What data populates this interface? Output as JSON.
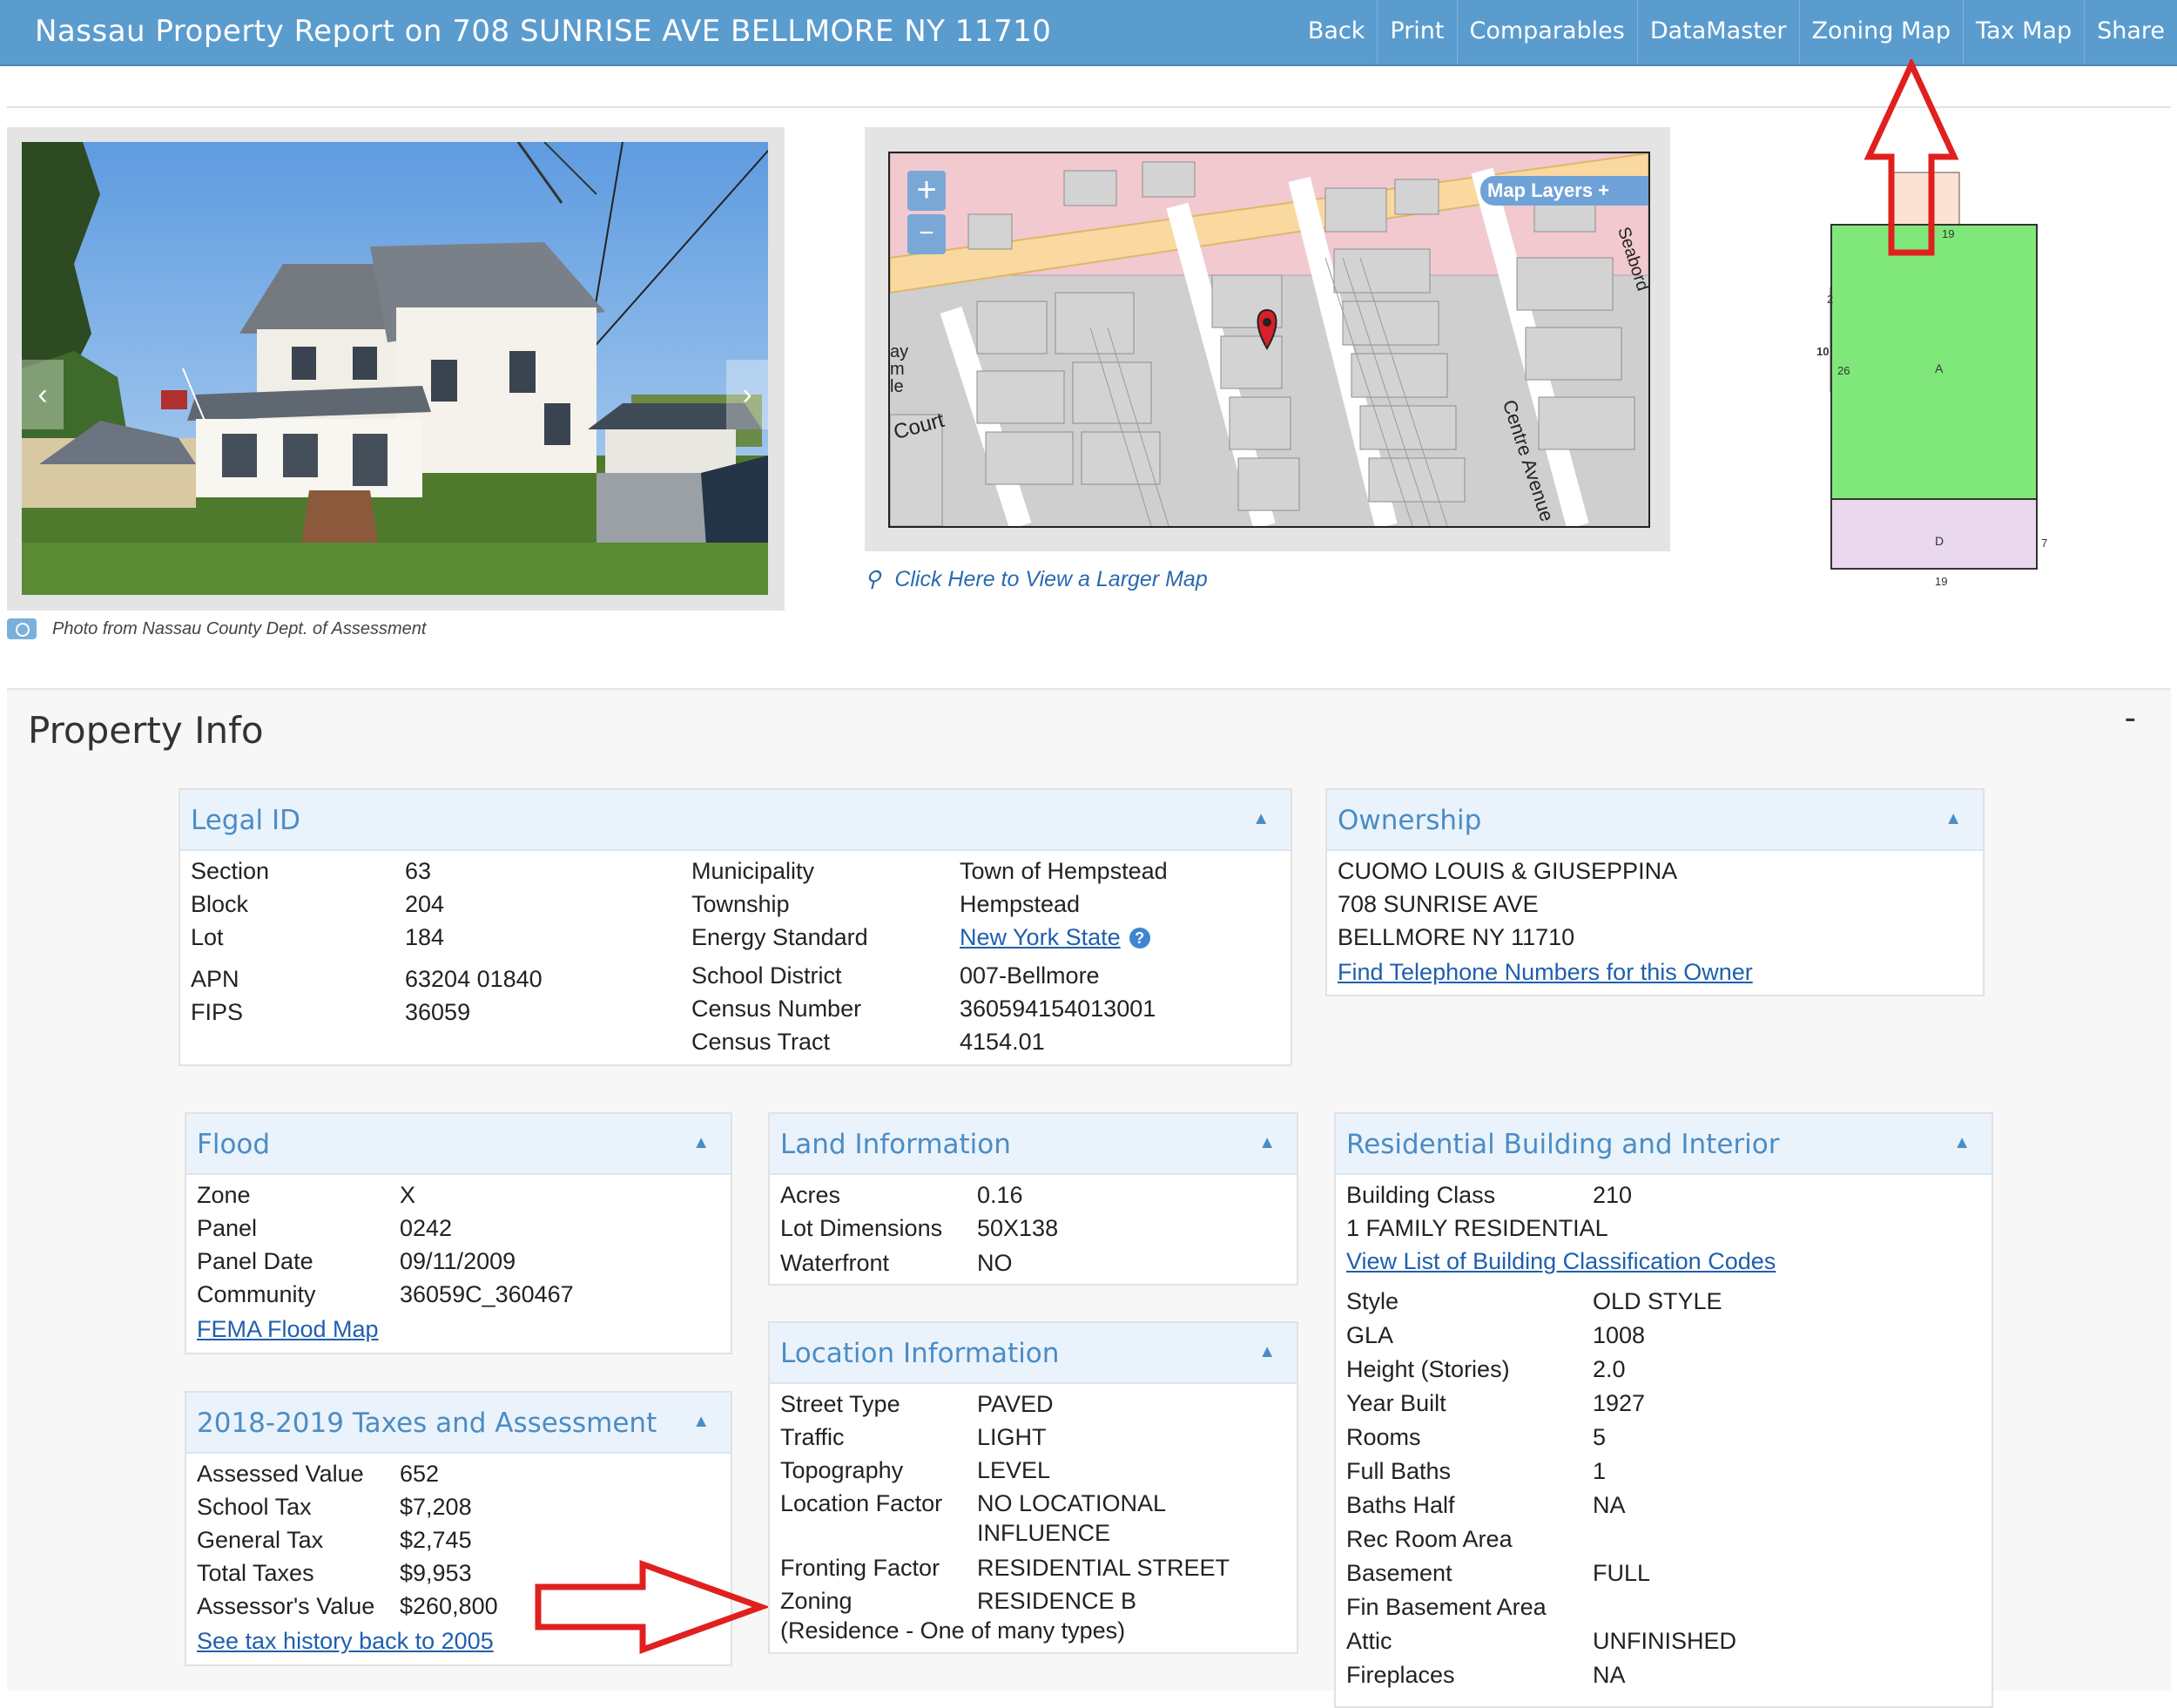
{
  "header": {
    "title": "Nassau Property Report on 708 SUNRISE AVE BELLMORE NY 11710",
    "nav": [
      "Back",
      "Print",
      "Comparables",
      "DataMaster",
      "Zoning Map",
      "Tax Map",
      "Share"
    ]
  },
  "photo": {
    "caption": "Photo from Nassau County Dept. of Assessment"
  },
  "map": {
    "layers_label": "Map Layers",
    "link_text": "Click Here to View a Larger Map",
    "street_labels": [
      "Court",
      "Centre Avenue",
      "Seabord"
    ],
    "partial_labels": [
      "ay",
      "m",
      "le"
    ]
  },
  "sketch": {
    "labels": [
      "A",
      "D",
      "19",
      "26",
      "10",
      "2",
      "7",
      "19"
    ]
  },
  "property_info": {
    "title": "Property Info",
    "collapse": "-"
  },
  "legal_id": {
    "title": "Legal ID",
    "left": [
      {
        "label": "Section",
        "value": "63"
      },
      {
        "label": "Block",
        "value": "204"
      },
      {
        "label": "Lot",
        "value": "184"
      },
      {
        "label": "APN",
        "value": "63204 01840"
      },
      {
        "label": "FIPS",
        "value": "36059"
      }
    ],
    "right": [
      {
        "label": "Municipality",
        "value": "Town of Hempstead"
      },
      {
        "label": "Township",
        "value": "Hempstead"
      },
      {
        "label": "Energy Standard",
        "value": "New York State"
      },
      {
        "label": "School District",
        "value": "007-Bellmore"
      },
      {
        "label": "Census Number",
        "value": "360594154013001"
      },
      {
        "label": "Census Tract",
        "value": "4154.01"
      }
    ]
  },
  "ownership": {
    "title": "Ownership",
    "name": "CUOMO LOUIS & GIUSEPPINA",
    "address1": "708 SUNRISE AVE",
    "address2": "BELLMORE NY 11710",
    "link": "Find Telephone Numbers for this Owner"
  },
  "flood": {
    "title": "Flood",
    "rows": [
      {
        "label": "Zone",
        "value": "X"
      },
      {
        "label": "Panel",
        "value": "0242"
      },
      {
        "label": "Panel Date",
        "value": "09/11/2009"
      },
      {
        "label": "Community",
        "value": "36059C_360467"
      }
    ],
    "link": "FEMA Flood Map"
  },
  "taxes": {
    "title": "2018-2019 Taxes and Assessment",
    "rows": [
      {
        "label": "Assessed Value",
        "value": "652"
      },
      {
        "label": "School Tax",
        "value": "$7,208"
      },
      {
        "label": "General Tax",
        "value": "$2,745"
      },
      {
        "label": "Total Taxes",
        "value": "$9,953"
      },
      {
        "label": "Assessor's Value",
        "value": "$260,800"
      }
    ],
    "link": "See tax history back to 2005"
  },
  "land": {
    "title": "Land Information",
    "rows": [
      {
        "label": "Acres",
        "value": "0.16"
      },
      {
        "label": "Lot Dimensions",
        "value": "50X138"
      },
      {
        "label": "Waterfront",
        "value": "NO"
      }
    ]
  },
  "location": {
    "title": "Location Information",
    "rows": [
      {
        "label": "Street Type",
        "value": "PAVED"
      },
      {
        "label": "Traffic",
        "value": "LIGHT"
      },
      {
        "label": "Topography",
        "value": "LEVEL"
      },
      {
        "label": "Location Factor",
        "value": "NO LOCATIONAL",
        "value2": "INFLUENCE"
      },
      {
        "label": "Fronting Factor",
        "value": "RESIDENTIAL STREET"
      },
      {
        "label": "Zoning",
        "value": "RESIDENCE B"
      }
    ],
    "zoning_note": "(Residence - One of many types)"
  },
  "residential": {
    "title": "Residential Building and Interior",
    "building_class_label": "Building Class",
    "building_class_value": "210",
    "class_desc": "1 FAMILY RESIDENTIAL",
    "link": "View List of Building Classification Codes",
    "rows": [
      {
        "label": "Style",
        "value": "OLD STYLE"
      },
      {
        "label": "GLA",
        "value": "1008"
      },
      {
        "label": "Height (Stories)",
        "value": "2.0"
      },
      {
        "label": "Year Built",
        "value": "1927"
      },
      {
        "label": "Rooms",
        "value": "5"
      },
      {
        "label": "Full Baths",
        "value": "1"
      },
      {
        "label": "Baths Half",
        "value": "NA"
      },
      {
        "label": "Rec Room Area",
        "value": ""
      },
      {
        "label": "Basement",
        "value": "FULL"
      },
      {
        "label": "Fin Basement Area",
        "value": ""
      },
      {
        "label": "Attic",
        "value": "UNFINISHED"
      },
      {
        "label": "Fireplaces",
        "value": "NA"
      }
    ]
  },
  "colors": {
    "header_bg": "#5b9ccf",
    "panel_title": "#4b8cc6",
    "link": "#1f5fae",
    "annotation_arrow": "#e0201e",
    "sketch_main": "#80e87a",
    "sketch_rear": "#ead8ee",
    "sketch_side": "#b77ed6"
  }
}
